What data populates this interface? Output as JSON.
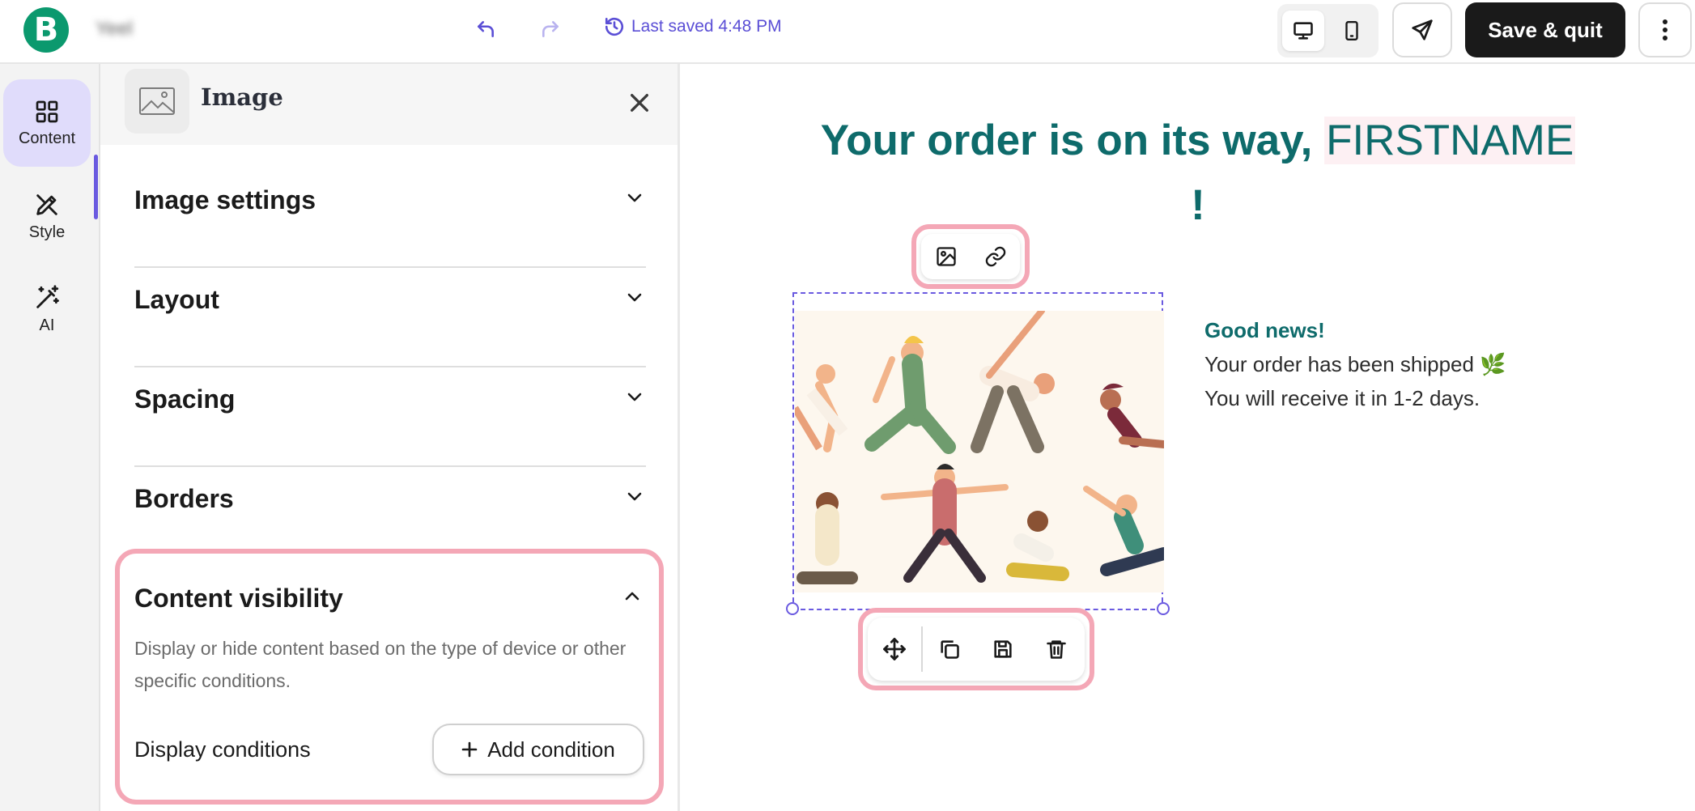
{
  "app": {
    "logo_letter": "B",
    "doc_title": "Yeel",
    "saved_status": "Last saved 4:48 PM",
    "save_quit_label": "Save & quit",
    "accent_color": "#6a5ae0",
    "brand_color": "#0b996e"
  },
  "rail": {
    "items": [
      {
        "label": "Content",
        "icon": "grid-icon",
        "active": true
      },
      {
        "label": "Style",
        "icon": "brush-icon",
        "active": false
      },
      {
        "label": "AI",
        "icon": "magic-wand-icon",
        "active": false
      }
    ]
  },
  "panel": {
    "title": "Image",
    "sections": [
      {
        "label": "Image settings"
      },
      {
        "label": "Layout"
      },
      {
        "label": "Spacing"
      },
      {
        "label": "Borders"
      }
    ],
    "visibility": {
      "title": "Content visibility",
      "description": "Display or hide content based on the type of device or other specific conditions.",
      "conditions_label": "Display conditions",
      "add_condition_label": "Add condition"
    }
  },
  "canvas": {
    "headline": "Your order is on its way, ",
    "headline_name": "FIRSTNAME",
    "headline_end": "!",
    "copy_title": "Good news!",
    "copy_line1": "Your order has been shipped 🌿",
    "copy_line2": "You will receive it in 1-2 days."
  }
}
